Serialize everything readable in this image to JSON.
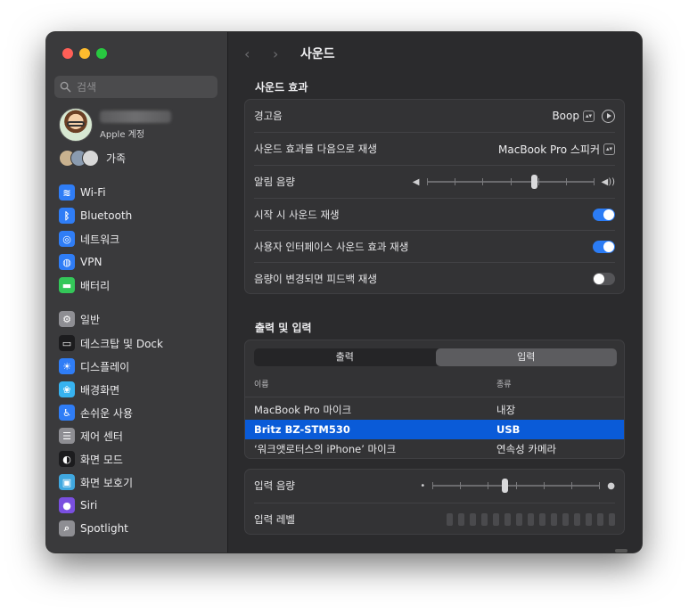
{
  "sidebar": {
    "search_placeholder": "검색",
    "profile_sub": "Apple 계정",
    "family_label": "가족",
    "items": [
      {
        "label": "Wi-Fi",
        "icon": "wifi-icon",
        "color": "#2f7df6",
        "glyph": "≋"
      },
      {
        "label": "Bluetooth",
        "icon": "bluetooth-icon",
        "color": "#2f7df6",
        "glyph": "ᛒ"
      },
      {
        "label": "네트워크",
        "icon": "globe-icon",
        "color": "#2f7df6",
        "glyph": "◎"
      },
      {
        "label": "VPN",
        "icon": "vpn-globe-icon",
        "color": "#2f7df6",
        "glyph": "◍"
      },
      {
        "label": "배터리",
        "icon": "battery-icon",
        "color": "#34c759",
        "glyph": "▬"
      },
      {
        "label": "일반",
        "icon": "gear-icon",
        "color": "#8e8e93",
        "glyph": "⚙"
      },
      {
        "label": "데스크탑 및 Dock",
        "icon": "dock-icon",
        "color": "#1c1c1e",
        "glyph": "▭"
      },
      {
        "label": "디스플레이",
        "icon": "display-sun-icon",
        "color": "#2f7df6",
        "glyph": "☀"
      },
      {
        "label": "배경화면",
        "icon": "wallpaper-flower-icon",
        "color": "#37b3f0",
        "glyph": "❀"
      },
      {
        "label": "손쉬운 사용",
        "icon": "accessibility-icon",
        "color": "#2f7df6",
        "glyph": "♿"
      },
      {
        "label": "제어 센터",
        "icon": "control-center-icon",
        "color": "#8e8e93",
        "glyph": "☰"
      },
      {
        "label": "화면 모드",
        "icon": "appearance-icon",
        "color": "#1c1c1e",
        "glyph": "◐"
      },
      {
        "label": "화면 보호기",
        "icon": "screensaver-icon",
        "color": "#40a8e0",
        "glyph": "▣"
      },
      {
        "label": "Siri",
        "icon": "siri-icon",
        "color": "#7a4fe0",
        "glyph": "●"
      },
      {
        "label": "Spotlight",
        "icon": "spotlight-search-icon",
        "color": "#8e8e93",
        "glyph": "⌕"
      }
    ]
  },
  "main": {
    "title": "사운드",
    "sound_effects": {
      "heading": "사운드 효과",
      "alert_sound_label": "경고음",
      "alert_sound_value": "Boop",
      "play_through_label": "사운드 효과를 다음으로 재생",
      "play_through_value": "MacBook Pro 스피커",
      "alert_volume_label": "알림 음량",
      "alert_volume_level": 0.64,
      "startup_label": "시작 시 사운드 재생",
      "startup_on": true,
      "ui_sounds_label": "사용자 인터페이스 사운드 효과 재생",
      "ui_sounds_on": true,
      "feedback_label": "음량이 변경되면 피드백 재생",
      "feedback_on": false
    },
    "io": {
      "heading": "출력 및 입력",
      "tabs": [
        "출력",
        "입력"
      ],
      "active_tab": 1,
      "col_name": "이름",
      "col_type": "종류",
      "devices": [
        {
          "name": "MacBook Pro 마이크",
          "type": "내장",
          "selected": false
        },
        {
          "name": "Britz BZ-STM530",
          "type": "USB",
          "selected": true
        },
        {
          "name": "‘워크앳로터스의 iPhone’ 마이크",
          "type": "연속성 카메라",
          "selected": false
        }
      ],
      "input_volume_label": "입력 음량",
      "input_volume_level": 0.43,
      "input_level_label": "입력 레벨",
      "input_level_segments": 15
    }
  },
  "colors": {
    "accent": "#2b7cf5",
    "selection": "#0a5bd8"
  }
}
